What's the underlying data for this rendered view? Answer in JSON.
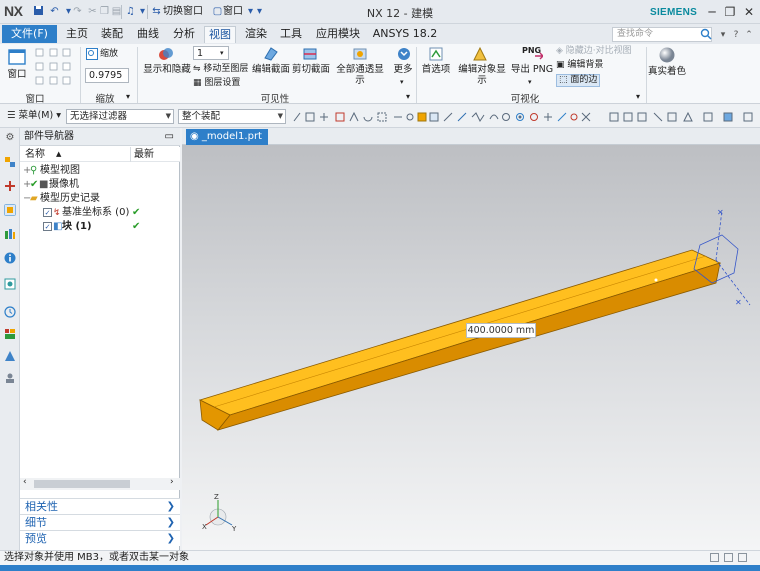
{
  "app": {
    "logo": "NX",
    "window_title": "NX 12 - 建模",
    "brand": "SIEMENS",
    "switch_window": "切换窗口",
    "window_menu": "窗口"
  },
  "menu": {
    "file": "文件(F)",
    "tabs": [
      "主页",
      "装配",
      "曲线",
      "分析",
      "视图",
      "渲染",
      "工具",
      "应用模块",
      "ANSYS 18.2"
    ],
    "active_tab": "视图",
    "search_placeholder": "查找命令"
  },
  "ribbon": {
    "groups": {
      "window": "窗口",
      "zoom": "缩放",
      "visibility": "可见性",
      "visualization": "可视化"
    },
    "window_btn": "窗口",
    "zoom_btn": "缩放",
    "zoom_value": "0.9795",
    "layer_value": "1",
    "show_hide": "显示和隐藏",
    "move_to_layer": "移动至图层",
    "layer_settings": "图层设置",
    "edit_section": "编辑截面",
    "clip_section": "剪切截面",
    "all_pass_display": "全部通透显示",
    "more": "更多",
    "preferences": "首选项",
    "edit_object_display": "编辑对象显示",
    "export_png_icon": "PNG",
    "export_png": "导出 PNG",
    "hidden_edges": "隐藏边·对比视图",
    "edit_background": "编辑背景",
    "face_edges": "面的边",
    "true_shading": "真实着色"
  },
  "selection_bar": {
    "menu": "菜单(M)",
    "filter": "无选择过滤器",
    "scope": "整个装配"
  },
  "navigator": {
    "title": "部件导航器",
    "col_name": "名称",
    "col_latest": "最新",
    "items": [
      {
        "label": "模型视图",
        "check": ""
      },
      {
        "label": "摄像机",
        "check": ""
      },
      {
        "label": "模型历史记录",
        "check": ""
      },
      {
        "label": "基准坐标系 (0)",
        "check": "✔"
      },
      {
        "label": "块 (1)",
        "check": "✔"
      }
    ],
    "panels": [
      "相关性",
      "细节",
      "预览"
    ]
  },
  "graphics": {
    "doc_tab": "_model1.prt",
    "dimension": "400.0000 mm",
    "beam_color": "#f0a400"
  },
  "status": {
    "message": "选择对象并使用 MB3，或者双击某一对象"
  },
  "colors": {
    "accent": "#2e7fc9",
    "brand": "#0a8a9e",
    "check": "#2a9d2a"
  }
}
